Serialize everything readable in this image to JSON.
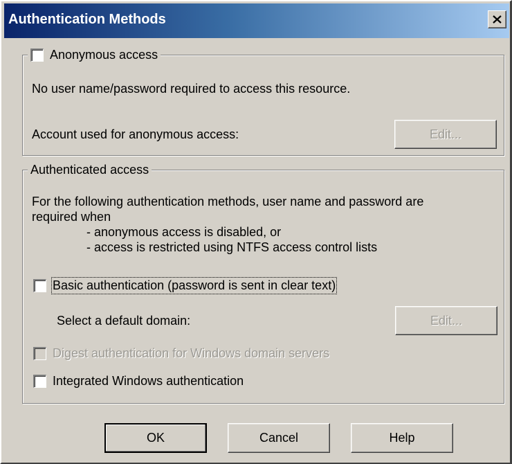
{
  "window": {
    "title": "Authentication Methods",
    "close_glyph": "✕"
  },
  "anonymous_group": {
    "checkbox_label": "Anonymous access",
    "checked": false,
    "description": "No user name/password required to access this resource.",
    "account_label": "Account used for anonymous access:",
    "edit_button": "Edit..."
  },
  "authenticated_group": {
    "legend": "Authenticated access",
    "description_line1": "For the following authentication methods, user name and password are",
    "description_line2": "required when",
    "bullet1": "- anonymous access is disabled, or",
    "bullet2": "- access is restricted using NTFS access control lists",
    "basic_auth": {
      "label": "Basic authentication (password is sent in clear text)",
      "checked": false
    },
    "default_domain_label": "Select a default domain:",
    "domain_edit_button": "Edit...",
    "digest_auth": {
      "label": "Digest authentication for Windows domain servers",
      "checked": false,
      "enabled": false
    },
    "integrated_auth": {
      "label": "Integrated Windows authentication",
      "checked": false
    }
  },
  "buttons": {
    "ok": "OK",
    "cancel": "Cancel",
    "help": "Help"
  }
}
